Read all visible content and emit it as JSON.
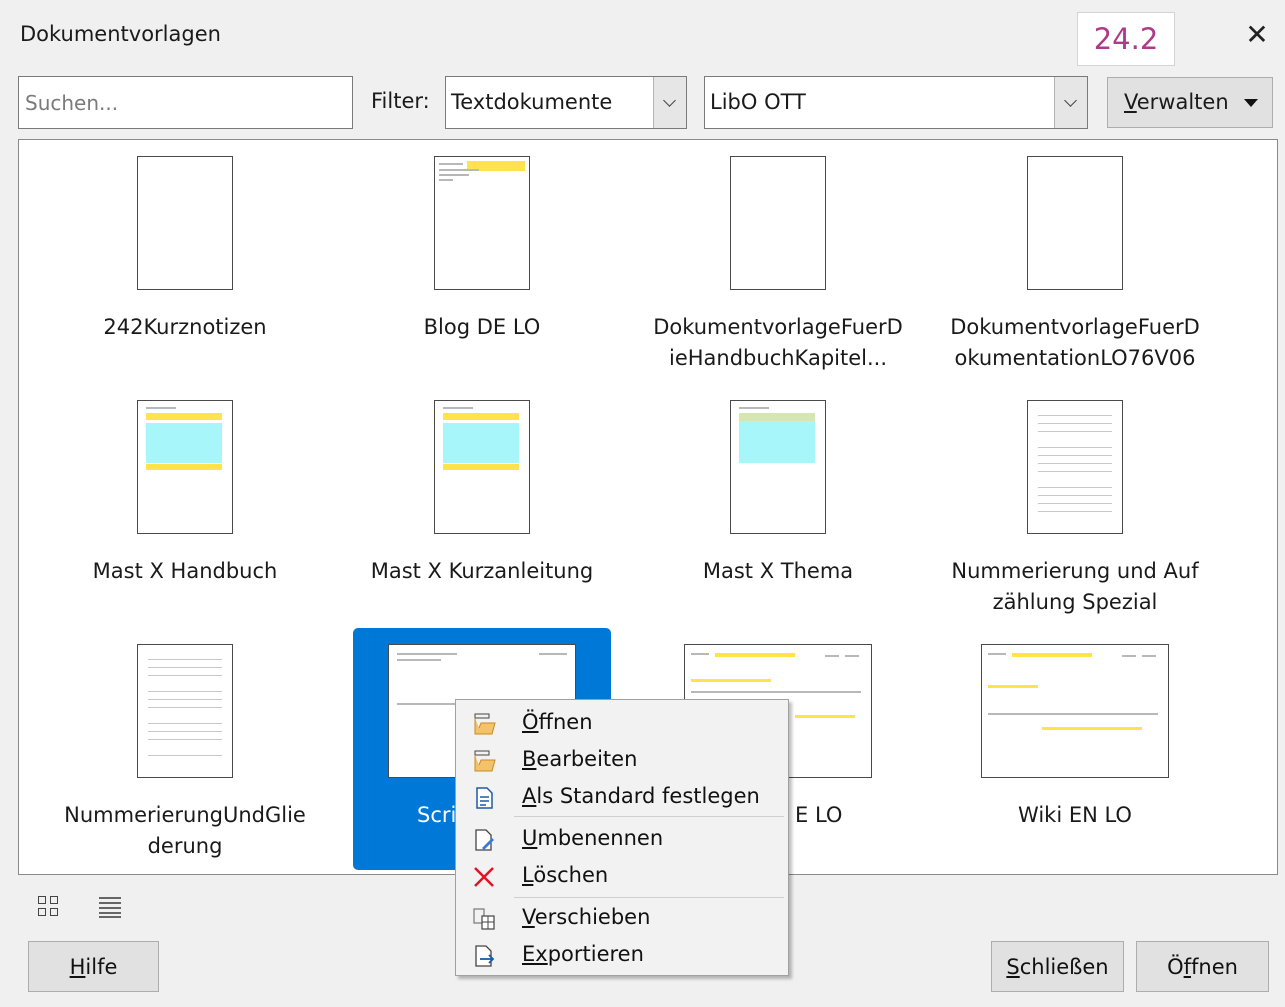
{
  "window": {
    "title": "Dokumentvorlagen",
    "version_badge": "24.2",
    "close_glyph": "✕"
  },
  "toolbar": {
    "search_placeholder": "Suchen...",
    "filter_label": "Filter:",
    "filter_value": "Textdokumente",
    "location_value": "LibO OTT",
    "manage_first": "V",
    "manage_rest": "erwalten"
  },
  "templates": [
    {
      "name": "242Kurznotizen"
    },
    {
      "name": "Blog DE LO"
    },
    {
      "name": "DokumentvorlageFuerDieHandbuchKapitel..."
    },
    {
      "name": "DokumentvorlageFuerDokumentationLO76V06"
    },
    {
      "name": "Mast X Handbuch"
    },
    {
      "name": "Mast X Kurzanleitung"
    },
    {
      "name": "Mast X Thema"
    },
    {
      "name": "Nummerierung und Aufzählung Spezial"
    },
    {
      "name": "NummerierungUndGliederung"
    },
    {
      "name": "Scri"
    },
    {
      "name": "E LO"
    },
    {
      "name": "Wiki EN LO"
    }
  ],
  "context_menu": [
    {
      "first": "Ö",
      "rest": "ffnen",
      "icon": "open-icon"
    },
    {
      "first": "B",
      "rest": "earbeiten",
      "icon": "edit-icon"
    },
    {
      "first": "A",
      "rest": "ls Standard festlegen",
      "icon": "set-default-icon"
    },
    {
      "first": "U",
      "rest": "mbenennen",
      "icon": "rename-icon"
    },
    {
      "first": "L",
      "rest": "öschen",
      "icon": "delete-icon"
    },
    {
      "first": "V",
      "rest": "erschieben",
      "icon": "move-icon"
    },
    {
      "first": "Ex",
      "rest": "portieren",
      "icon": "export-icon"
    }
  ],
  "footer": {
    "help_first": "H",
    "help_rest": "ilfe",
    "close_first": "S",
    "close_rest": "chließen",
    "open_before": "Ö",
    "open_under": "f",
    "open_rest": "fnen"
  },
  "colors": {
    "selection": "#0078d7",
    "version_text": "#b03a8a",
    "delete_icon": "#e81123"
  }
}
